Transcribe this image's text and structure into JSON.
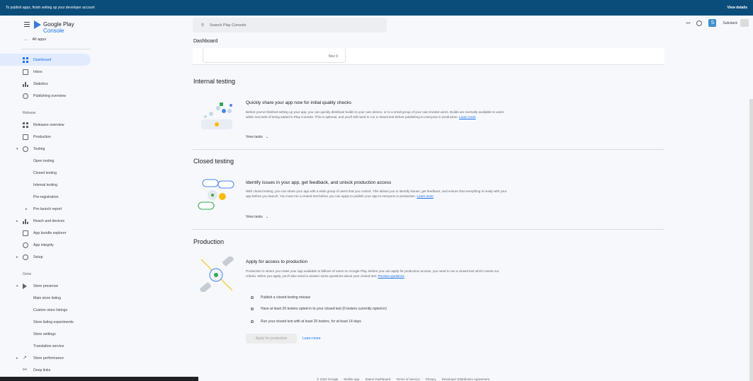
{
  "banner": {
    "message": "To publish apps, finish setting up your developer account",
    "action": "View details"
  },
  "brand": {
    "name": "Google Play",
    "suffix": "Console"
  },
  "all_apps": "All apps",
  "search": {
    "placeholder": "Search Play Console"
  },
  "app_chip": {
    "name": "Substack"
  },
  "page_title": "Dashboard",
  "top_card_date": "Nov 9",
  "nav_top": [
    {
      "label": "Dashboard",
      "icon": "dashboard-icon",
      "active": true
    },
    {
      "label": "Inbox",
      "icon": "inbox-icon"
    },
    {
      "label": "Statistics",
      "icon": "statistics-icon"
    },
    {
      "label": "Publishing overview",
      "icon": "publishing-overview-icon"
    }
  ],
  "release_label": "Release",
  "nav_release": [
    {
      "label": "Releases overview"
    },
    {
      "label": "Production"
    },
    {
      "label": "Testing"
    },
    {
      "label": "Open testing"
    },
    {
      "label": "Closed testing"
    },
    {
      "label": "Internal testing"
    },
    {
      "label": "Pre-registration"
    },
    {
      "label": "Pre-launch report"
    },
    {
      "label": "Reach and devices"
    },
    {
      "label": "App bundle explorer"
    },
    {
      "label": "App integrity"
    },
    {
      "label": "Setup"
    }
  ],
  "grow_label": "Grow",
  "nav_grow": [
    {
      "label": "Store presence"
    },
    {
      "label": "Main store listing"
    },
    {
      "label": "Custom store listings"
    },
    {
      "label": "Store listing experiments"
    },
    {
      "label": "Store settings"
    },
    {
      "label": "Translation service"
    },
    {
      "label": "Store performance"
    },
    {
      "label": "Deep links"
    }
  ],
  "internal": {
    "section_title": "Internal testing",
    "heading": "Quickly share your app now for initial quality checks",
    "desc": "Before you've finished setting up your app, you can quickly distribute builds to your own device, or to a small group of your own trusted users. Builds are normally available to users within seconds of being added in Play Console. This is optional, and you'll still need to run a closed test before publishing to everyone in production.",
    "learn_more": "Learn more",
    "view_tasks": "View tasks"
  },
  "closed": {
    "section_title": "Closed testing",
    "heading": "Identify issues in your app, get feedback, and unlock production access",
    "desc": "With closed testing, you can share your app with a wide group of users that you control. This allows you to identify issues, get feedback, and ensure that everything is ready with your app before you launch. You must run a closed test before you can apply to publish your app to everyone in production.",
    "learn_more": "Learn more",
    "view_tasks": "View tasks"
  },
  "production": {
    "section_title": "Production",
    "heading": "Apply for access to production",
    "desc": "Production is where you make your app available to billions of users on Google Play. Before you can apply for production access, you need to run a closed test which meets our criteria. When you apply, you'll also need to answer some questions about your closed test.",
    "preview_link": "Preview questions",
    "tasks": [
      "Publish a closed testing release",
      "Have at least 20 testers opted-in to your closed test (0 testers currently opted-in)",
      "Run your closed test with at least 20 testers, for at least 14 days"
    ],
    "apply_button": "Apply for production",
    "learn_more": "Learn more"
  },
  "footer": [
    "© 2024 Google",
    "Mobile app",
    "Status Dashboard",
    "Terms of Service",
    "Privacy",
    "Developer Distribution Agreement"
  ],
  "colors": {
    "banner": "#0b4d7a",
    "accent": "#1a73e8",
    "active_bg": "#e1ebfd"
  }
}
